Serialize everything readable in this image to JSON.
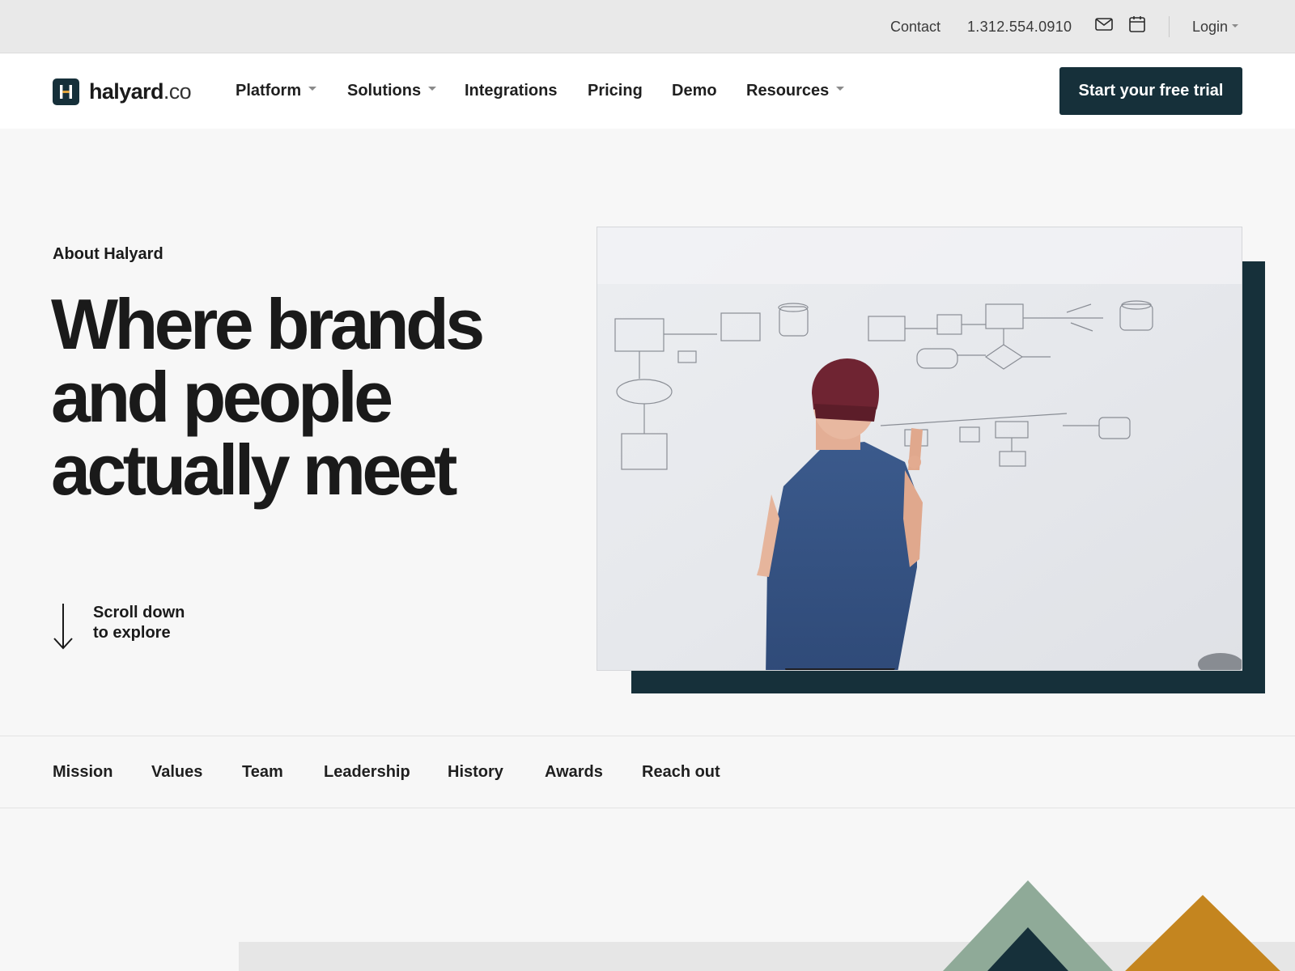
{
  "utility_bar": {
    "contact": "Contact",
    "phone": "1.312.554.0910",
    "mail_icon": "mail-icon",
    "calendar_icon": "calendar-icon",
    "login": "Login"
  },
  "nav": {
    "logo_name": "halyard",
    "logo_tld": ".co",
    "items": [
      {
        "label": "Platform",
        "dropdown": true
      },
      {
        "label": "Solutions",
        "dropdown": true
      },
      {
        "label": "Integrations",
        "dropdown": false
      },
      {
        "label": "Pricing",
        "dropdown": false
      },
      {
        "label": "Demo",
        "dropdown": false
      },
      {
        "label": "Resources",
        "dropdown": true
      }
    ],
    "cta": "Start your free trial"
  },
  "hero": {
    "eyebrow": "About Halyard",
    "headline": [
      "Where brands",
      "and people",
      "actually meet"
    ],
    "scroll_hint": [
      "Scroll down",
      "to explore"
    ]
  },
  "section_tabs": [
    "Mission",
    "Values",
    "Team",
    "Leadership",
    "History",
    "Awards",
    "Reach out"
  ],
  "colors": {
    "brand_dark": "#16303a",
    "sage": "#8faa98",
    "amber": "#c4851f",
    "utility_bg": "#e9e9e9",
    "page_bg": "#f7f7f7"
  }
}
